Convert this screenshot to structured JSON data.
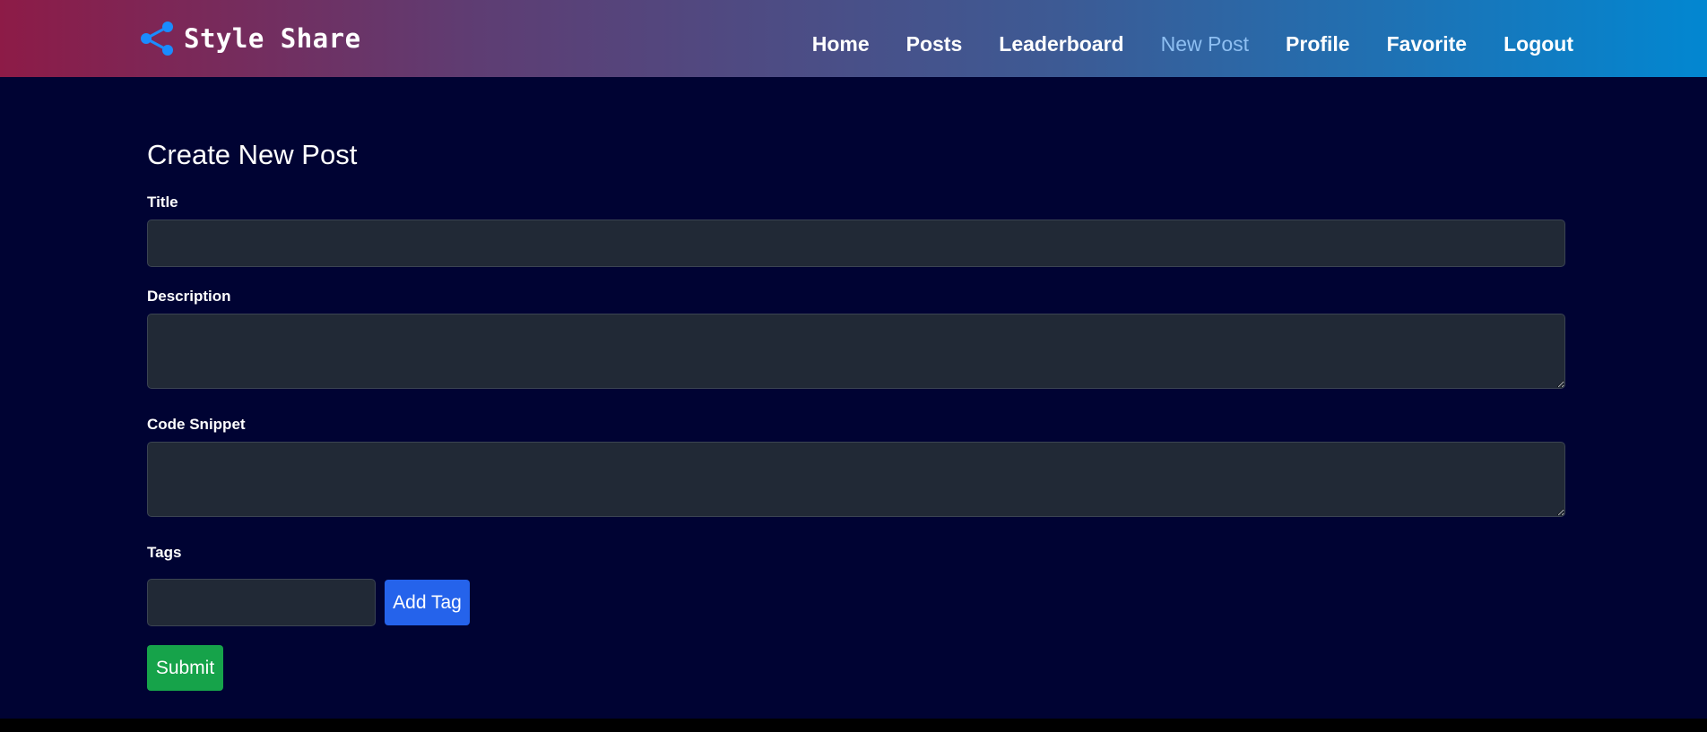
{
  "brand": {
    "name": "Style Share",
    "icon": "share-icon"
  },
  "nav": {
    "items": [
      {
        "label": "Home"
      },
      {
        "label": "Posts"
      },
      {
        "label": "Leaderboard"
      },
      {
        "label": "New Post",
        "active": true
      },
      {
        "label": "Profile"
      },
      {
        "label": "Favorite"
      },
      {
        "label": "Logout"
      }
    ]
  },
  "form": {
    "heading": "Create New Post",
    "title_label": "Title",
    "title_value": "",
    "description_label": "Description",
    "description_value": "",
    "code_label": "Code Snippet",
    "code_value": "",
    "tags_label": "Tags",
    "tag_value": "",
    "add_tag_label": "Add Tag",
    "submit_label": "Submit"
  },
  "colors": {
    "page_background": "#000333",
    "navbar_gradient_start": "#8d1b47",
    "navbar_gradient_end": "#0287d1",
    "active_nav": "#8ebff2",
    "input_background": "#212936",
    "add_tag_button": "#2563eb",
    "submit_button": "#16a34a"
  }
}
